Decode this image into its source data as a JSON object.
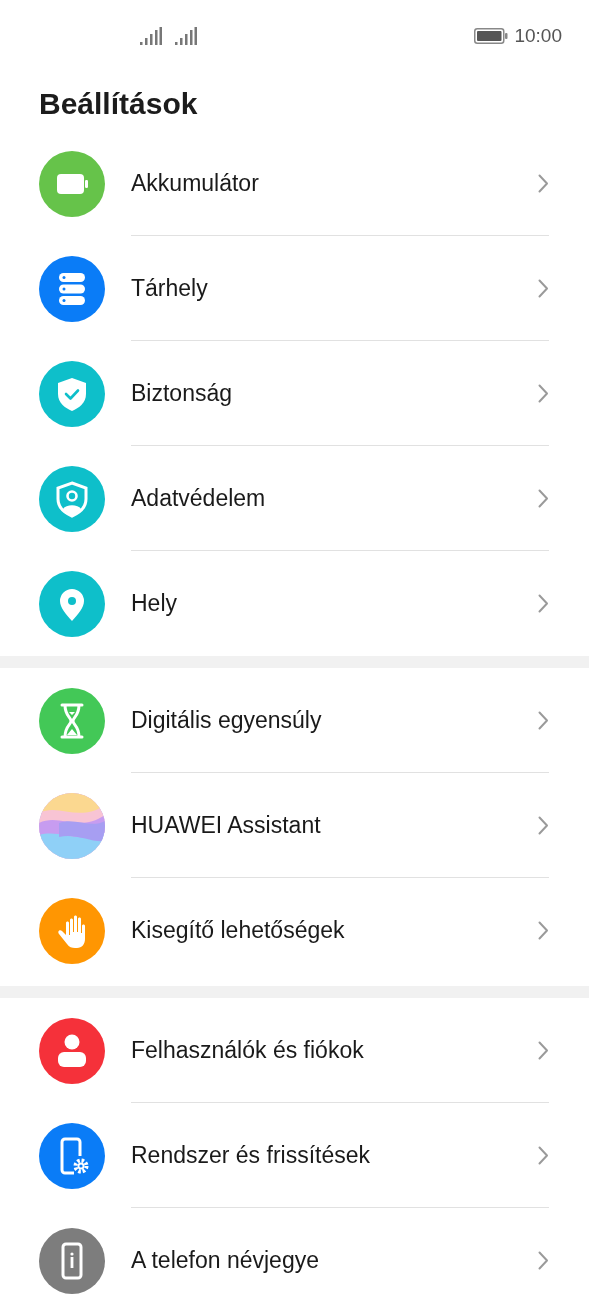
{
  "status_bar": {
    "time": "10:00"
  },
  "title": "Beállítások",
  "groups": [
    {
      "items": [
        {
          "label": "Akkumulátor",
          "kind": "battery",
          "color": "#66c34a"
        },
        {
          "label": "Tárhely",
          "kind": "storage",
          "color": "#0a7cf7"
        },
        {
          "label": "Biztonság",
          "kind": "shield",
          "color": "#0ebfca"
        },
        {
          "label": "Adatvédelem",
          "kind": "privacy",
          "color": "#0ebfca"
        },
        {
          "label": "Hely",
          "kind": "location",
          "color": "#0ebfca"
        }
      ]
    },
    {
      "items": [
        {
          "label": "Digitális egyensúly",
          "kind": "hourglass",
          "color": "#43c857"
        },
        {
          "label": "HUAWEI Assistant",
          "kind": "assistant",
          "color": "#a79ef2"
        },
        {
          "label": "Kisegítő lehetőségek",
          "kind": "hand",
          "color": "#ff9602"
        }
      ]
    },
    {
      "items": [
        {
          "label": "Felhasználók és fiókok",
          "kind": "user",
          "color": "#f5313a"
        },
        {
          "label": "Rendszer és frissítések",
          "kind": "phone-gear",
          "color": "#0a7cf7"
        },
        {
          "label": "A telefon névjegye",
          "kind": "phone-info",
          "color": "#7d7d7d"
        }
      ]
    }
  ]
}
